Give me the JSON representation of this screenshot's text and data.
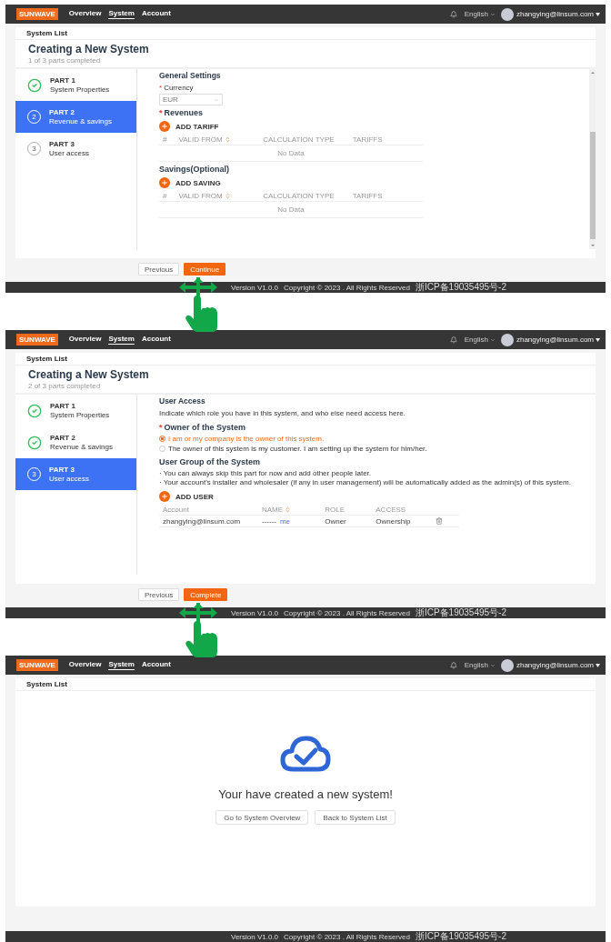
{
  "screens": [
    {
      "kind": "wizard",
      "header": {
        "logo": "SUNWAVE",
        "nav": [
          {
            "label": "Overview",
            "selected": false
          },
          {
            "label": "System",
            "selected": true
          },
          {
            "label": "Account",
            "selected": false
          }
        ],
        "language": "English",
        "user": "zhangying@linsum.com"
      },
      "breadcrumb": "System List",
      "title": "Creating a New System",
      "progress": "1 of 3 parts completed",
      "steps": [
        {
          "part": "PART 1",
          "name": "System Properties",
          "completed": true,
          "selected": false
        },
        {
          "part": "PART 2",
          "name": "Revenue & savings",
          "number": "2",
          "completed": false,
          "selected": true
        },
        {
          "part": "PART 3",
          "name": "User access",
          "number": "3",
          "completed": false,
          "selected": false
        }
      ],
      "content": {
        "scrollable": true,
        "blocks": [
          {
            "kind": "title",
            "text": "General Settings"
          },
          {
            "kind": "select",
            "mark": "*",
            "label": "Currency",
            "value": "EUR"
          },
          {
            "kind": "heading",
            "mark": "*",
            "text": "Revenues"
          },
          {
            "kind": "add",
            "label": "ADD TARIFF"
          },
          {
            "kind": "table",
            "columns": [
              {
                "label": "#",
                "sortable": false
              },
              {
                "label": "VALID FROM",
                "sortable": true
              },
              {
                "label": "CALCULATION TYPE",
                "sortable": false
              },
              {
                "label": "TARIFFS",
                "sortable": false
              }
            ],
            "empty": "No Data"
          },
          {
            "kind": "heading",
            "text": "Savings(Optional)"
          },
          {
            "kind": "add",
            "label": "ADD SAVING"
          },
          {
            "kind": "table",
            "columns": [
              {
                "label": "#",
                "sortable": false
              },
              {
                "label": "VALID FROM",
                "sortable": true
              },
              {
                "label": "CALCULATION TYPE",
                "sortable": false
              },
              {
                "label": "TARIFFS",
                "sortable": false
              }
            ],
            "empty": "No Data"
          }
        ]
      },
      "buttons": [
        {
          "label": "Previous",
          "primary": false
        },
        {
          "label": "Continue",
          "primary": true
        }
      ],
      "footer": {
        "version": "Version V1.0.0",
        "copyright": "Copyright © 2023 . All Rights Reserved",
        "license": "浙ICP备19035495号-2"
      }
    },
    {
      "kind": "wizard",
      "header": {
        "logo": "SUNWAVE",
        "nav": [
          {
            "label": "Overview",
            "selected": false
          },
          {
            "label": "System",
            "selected": true
          },
          {
            "label": "Account",
            "selected": false
          }
        ],
        "language": "English",
        "user": "zhangying@linsum.com"
      },
      "breadcrumb": "System List",
      "title": "Creating a New System",
      "progress": "2 of 3 parts completed",
      "steps": [
        {
          "part": "PART 1",
          "name": "System Properties",
          "completed": true,
          "selected": false
        },
        {
          "part": "PART 2",
          "name": "Revenue & savings",
          "completed": true,
          "selected": false
        },
        {
          "part": "PART 3",
          "name": "User access",
          "number": "3",
          "completed": false,
          "selected": true
        }
      ],
      "content": {
        "scrollable": false,
        "blocks": [
          {
            "kind": "title",
            "text": "User Access"
          },
          {
            "kind": "text",
            "text": "Indicate which role you have in this system, and who else need access here."
          },
          {
            "kind": "radio",
            "mark": "*",
            "label": "Owner of the System",
            "options": [
              {
                "label": "I am or my company is the owner of this system.",
                "selected": true
              },
              {
                "label": "The owner of this system is my customer. I am setting up the system for him/her.",
                "selected": false
              }
            ]
          },
          {
            "kind": "heading",
            "text": "User Group of the System"
          },
          {
            "kind": "bullets",
            "items": [
              "· You can always skip this part for now and add other people later.",
              "· Your account's installer and wholesaler (if any in user management) will be automatically added as the admin(s) of this system."
            ]
          },
          {
            "kind": "add",
            "label": "ADD USER"
          },
          {
            "kind": "table",
            "columns": [
              {
                "label": "Account",
                "sortable": false
              },
              {
                "label": "NAME",
                "sortable": true
              },
              {
                "label": "ROLE",
                "sortable": false
              },
              {
                "label": "ACCESS",
                "sortable": false
              }
            ],
            "rows": [
              {
                "account": "zhangying@linsum.com",
                "name": "------",
                "tag": "me",
                "role": "Owner",
                "access": "Ownership",
                "deletable": true
              }
            ]
          }
        ]
      },
      "buttons": [
        {
          "label": "Previous",
          "primary": false
        },
        {
          "label": "Complete",
          "primary": true
        }
      ],
      "footer": {
        "version": "Version V1.0.0",
        "copyright": "Copyright © 2023 . All Rights Reserved",
        "license": "浙ICP备19035495号-2"
      }
    },
    {
      "kind": "success",
      "header": {
        "logo": "SUNWAVE",
        "nav": [
          {
            "label": "Overview",
            "selected": false
          },
          {
            "label": "System",
            "selected": true
          },
          {
            "label": "Account",
            "selected": false
          }
        ],
        "language": "English",
        "user": "zhangying@linsum.com"
      },
      "breadcrumb": "System List",
      "message": "Your have created a new system!",
      "buttons": [
        {
          "label": "Go to System Overview",
          "primary": false
        },
        {
          "label": "Back to System List",
          "primary": false
        }
      ],
      "footer": {
        "version": "Version V1.0.0",
        "copyright": "Copyright © 2023 . All Rights Reserved",
        "license": "浙ICP备19035495号-2"
      }
    }
  ]
}
